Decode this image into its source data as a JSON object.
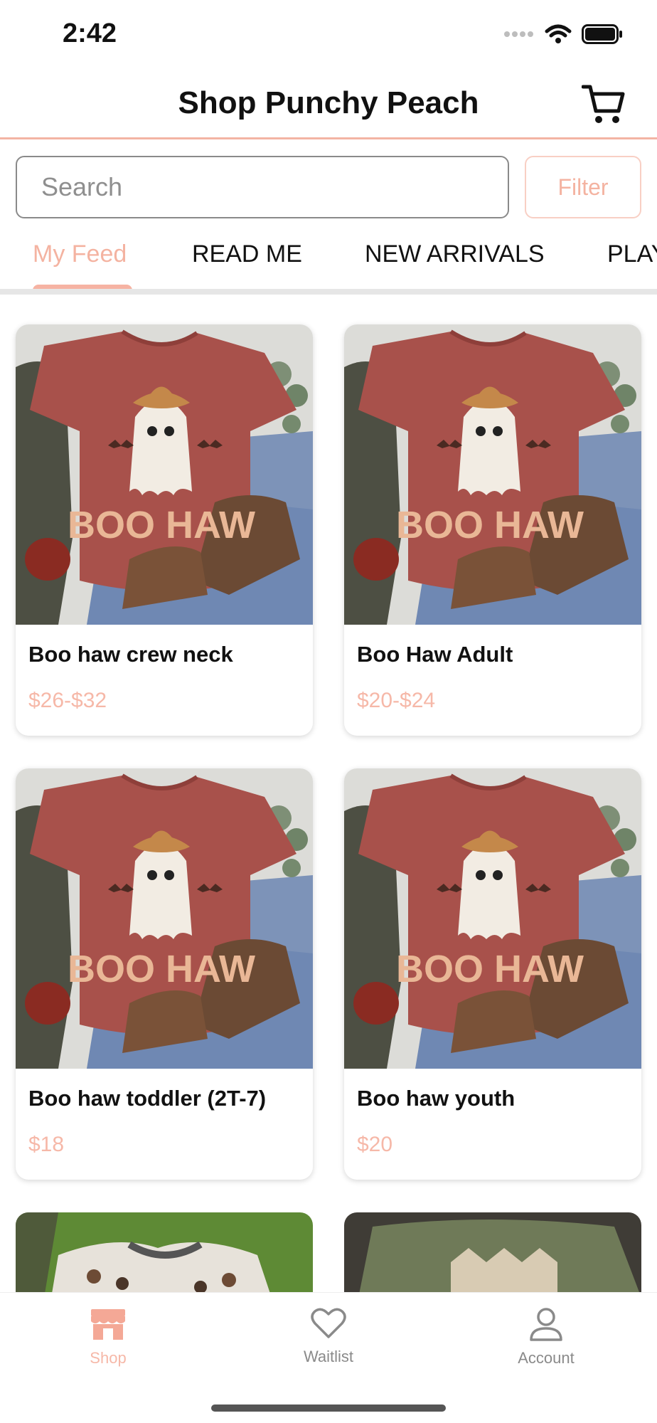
{
  "status_bar": {
    "time": "2:42",
    "icons": [
      "signal-icon",
      "wifi-icon",
      "battery-icon"
    ]
  },
  "header": {
    "title": "Shop Punchy Peach",
    "cart_icon": "cart-icon"
  },
  "search": {
    "placeholder": "Search",
    "value": ""
  },
  "filter": {
    "label": "Filter"
  },
  "tabs": [
    {
      "label": "My Feed",
      "active": true
    },
    {
      "label": "READ ME",
      "active": false
    },
    {
      "label": "NEW ARRIVALS",
      "active": false
    },
    {
      "label": "PLAY",
      "active": false
    }
  ],
  "products": [
    {
      "title": "Boo haw crew neck",
      "price": "$26-$32"
    },
    {
      "title": "Boo Haw Adult",
      "price": "$20-$24"
    },
    {
      "title": "Boo haw toddler (2T-7)",
      "price": "$18"
    },
    {
      "title": "Boo haw youth",
      "price": "$20"
    }
  ],
  "product_image_text": "BOO HAW",
  "bottom_nav": [
    {
      "label": "Shop",
      "icon": "store-icon",
      "active": true
    },
    {
      "label": "Waitlist",
      "icon": "heart-icon",
      "active": false
    },
    {
      "label": "Account",
      "icon": "user-icon",
      "active": false
    }
  ],
  "colors": {
    "accent": "#f4b3a1",
    "accent_light": "#f6b8a8",
    "text": "#111111",
    "muted": "#8a8a8a"
  }
}
